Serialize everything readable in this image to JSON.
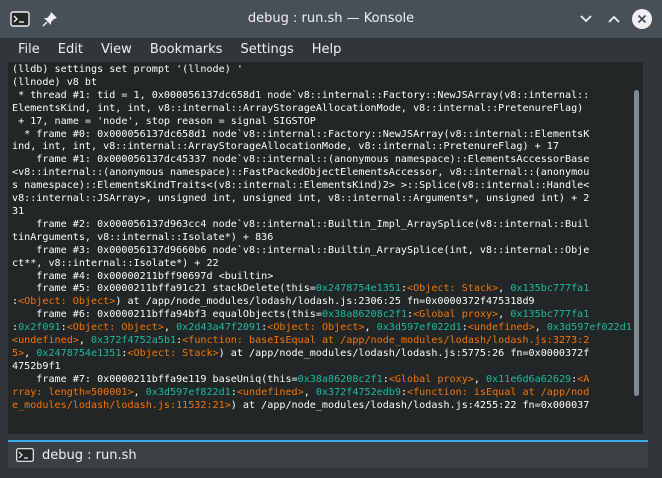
{
  "window": {
    "title": "debug : run.sh — Konsole",
    "icons": [
      "konsole-app-icon",
      "pin-icon",
      "chevron-down-icon",
      "chevron-up-icon",
      "close-icon"
    ]
  },
  "menu": [
    "File",
    "Edit",
    "View",
    "Bookmarks",
    "Settings",
    "Help"
  ],
  "terminal": {
    "lines": [
      [
        {
          "t": "(lldb) settings set prompt '(llnode) '"
        }
      ],
      [
        {
          "t": "(llnode) v8 bt"
        }
      ],
      [
        {
          "t": " * thread #1: tid = 1, 0x000056137dc658d1 node`v8::internal::Factory::NewJSArray(v8::internal::"
        }
      ],
      [
        {
          "t": "ElementsKind, int, int, v8::internal::ArrayStorageAllocationMode, v8::internal::PretenureFlag)"
        }
      ],
      [
        {
          "t": " + 17, name = 'node', stop reason = signal SIGSTOP"
        }
      ],
      [
        {
          "t": "  * frame #0: 0x000056137dc658d1 node`v8::internal::Factory::NewJSArray(v8::internal::ElementsK"
        }
      ],
      [
        {
          "t": "ind, int, int, v8::internal::ArrayStorageAllocationMode, v8::internal::PretenureFlag) + 17"
        }
      ],
      [
        {
          "t": "    frame #1: 0x000056137dc45337 node`v8::internal::(anonymous namespace)::ElementsAccessorBase"
        }
      ],
      [
        {
          "t": "<v8::internal::(anonymous namespace)::FastPackedObjectElementsAccessor, v8::internal::(anonymou"
        }
      ],
      [
        {
          "t": "s namespace)::ElementsKindTraits<(v8::internal::ElementsKind)2> >::Splice(v8::internal::Handle<"
        }
      ],
      [
        {
          "t": "v8::internal::JSArray>, unsigned int, unsigned int, v8::internal::Arguments*, unsigned int) + 2"
        }
      ],
      [
        {
          "t": "31"
        }
      ],
      [
        {
          "t": "    frame #2: 0x000056137d963cc4 node`v8::internal::Builtin_Impl_ArraySplice(v8::internal::Buil"
        }
      ],
      [
        {
          "t": "tinArguments, v8::internal::Isolate*) + 836"
        }
      ],
      [
        {
          "t": "    frame #3: 0x000056137d9660b6 node`v8::internal::Builtin_ArraySplice(int, v8::internal::Obje"
        }
      ],
      [
        {
          "t": "ct**, v8::internal::Isolate*) + 22"
        }
      ],
      [
        {
          "t": "    frame #4: 0x00000211bff90697d <builtin>"
        }
      ],
      [
        {
          "t": "    frame #5: 0x0000211bffa91c21 stackDelete(this="
        },
        {
          "t": "0x2478754e1351",
          "c": "cyan"
        },
        {
          "t": ":"
        },
        {
          "t": "<Object: Stack>",
          "c": "orange"
        },
        {
          "t": ", "
        },
        {
          "t": "0x135bc777fa1",
          "c": "cyan"
        }
      ],
      [
        {
          "t": ":"
        },
        {
          "t": "<Object: Object>",
          "c": "orange"
        },
        {
          "t": ") at /app/node_modules/lodash/lodash.js:2306:25 fn=0x0000372f475318d9"
        }
      ],
      [
        {
          "t": "    frame #6: 0x0000211bffa94bf3 equalObjects(this="
        },
        {
          "t": "0x38a86208c2f1",
          "c": "cyan"
        },
        {
          "t": ":"
        },
        {
          "t": "<Global proxy>",
          "c": "orange"
        },
        {
          "t": ", "
        },
        {
          "t": "0x135bc777fa1",
          "c": "cyan"
        }
      ],
      [
        {
          "t": ":"
        },
        {
          "t": "0x2f091",
          "c": "cyan"
        },
        {
          "t": ":"
        },
        {
          "t": "<Object: Object>",
          "c": "orange"
        },
        {
          "t": ", "
        },
        {
          "t": "0x2d43a47f2091",
          "c": "cyan"
        },
        {
          "t": ":"
        },
        {
          "t": "<Object: Object>",
          "c": "orange"
        },
        {
          "t": ", "
        },
        {
          "t": "0x3d597ef022d1",
          "c": "cyan"
        },
        {
          "t": ":"
        },
        {
          "t": "<undefined>",
          "c": "orange"
        },
        {
          "t": ", "
        },
        {
          "t": "0x3d597ef022d1",
          "c": "cyan"
        },
        {
          "t": ":"
        }
      ],
      [
        {
          "t": "<undefined>",
          "c": "orange"
        },
        {
          "t": ", "
        },
        {
          "t": "0x372f4752a5b1",
          "c": "cyan"
        },
        {
          "t": ":"
        },
        {
          "t": "<function: baseIsEqual at /app/node_modules/lodash/lodash.js:3273:2",
          "c": "orange"
        }
      ],
      [
        {
          "t": "5>",
          "c": "orange"
        },
        {
          "t": ", "
        },
        {
          "t": "0x2478754e1351",
          "c": "cyan"
        },
        {
          "t": ":"
        },
        {
          "t": "<Object: Stack>",
          "c": "orange"
        },
        {
          "t": ") at /app/node_modules/lodash/lodash.js:5775:26 fn=0x0000372f"
        }
      ],
      [
        {
          "t": "4752b9f1"
        }
      ],
      [
        {
          "t": "    frame #7: 0x0000211bffa9e119 baseUniq(this="
        },
        {
          "t": "0x38a86208c2f1",
          "c": "cyan"
        },
        {
          "t": ":"
        },
        {
          "t": "<Global proxy>",
          "c": "orange"
        },
        {
          "t": ", "
        },
        {
          "t": "0x11e6d6a62629",
          "c": "cyan"
        },
        {
          "t": ":"
        },
        {
          "t": "<A",
          "c": "orange"
        }
      ],
      [
        {
          "t": "rray: length=500001>",
          "c": "orange"
        },
        {
          "t": ", "
        },
        {
          "t": "0x3d597ef822d1",
          "c": "cyan"
        },
        {
          "t": ":"
        },
        {
          "t": "<undefined>",
          "c": "orange"
        },
        {
          "t": ", "
        },
        {
          "t": "0x372f4752edb9",
          "c": "cyan"
        },
        {
          "t": ":"
        },
        {
          "t": "<function: isEqual at /app/nod",
          "c": "orange"
        }
      ],
      [
        {
          "t": "e_modules/lodash/lodash.js:11532:21>",
          "c": "orange"
        },
        {
          "t": ") at /app/node_modules/lodash/lodash.js:4255:22 fn=0x000037"
        }
      ]
    ]
  },
  "tab": {
    "label": "debug : run.sh",
    "icon": "terminal-icon"
  },
  "colors": {
    "titlebar": "#475057",
    "window_bg": "#31363b",
    "terminal_bg": "#232627",
    "text": "#fcfcfc",
    "address": "#1abc9c",
    "object": "#f67400",
    "tab_accent": "#3daee9"
  }
}
